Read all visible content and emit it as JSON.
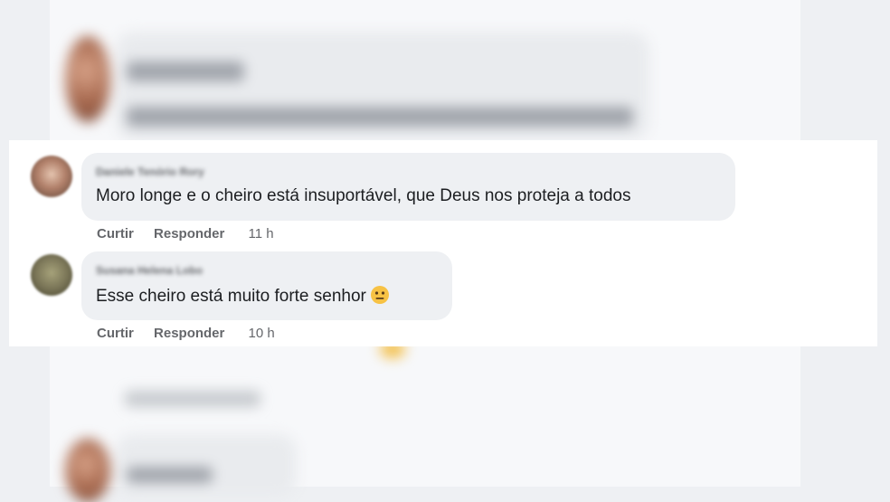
{
  "comments": [
    {
      "author": "Daniele Tenório Rory",
      "text": "Moro longe e o cheiro está insuportável, que Deus nos proteja a todos",
      "like_label": "Curtir",
      "reply_label": "Responder",
      "time": "11 h"
    },
    {
      "author": "Susana Helena Lobo",
      "text": "Esse cheiro está muito forte senhor",
      "emoji": "neutral-face-icon",
      "like_label": "Curtir",
      "reply_label": "Responder",
      "time": "10 h"
    }
  ],
  "colors": {
    "bubble": "#eef0f3",
    "text": "#1c1e21",
    "meta": "#65676b",
    "emoji": "#f7c244"
  }
}
